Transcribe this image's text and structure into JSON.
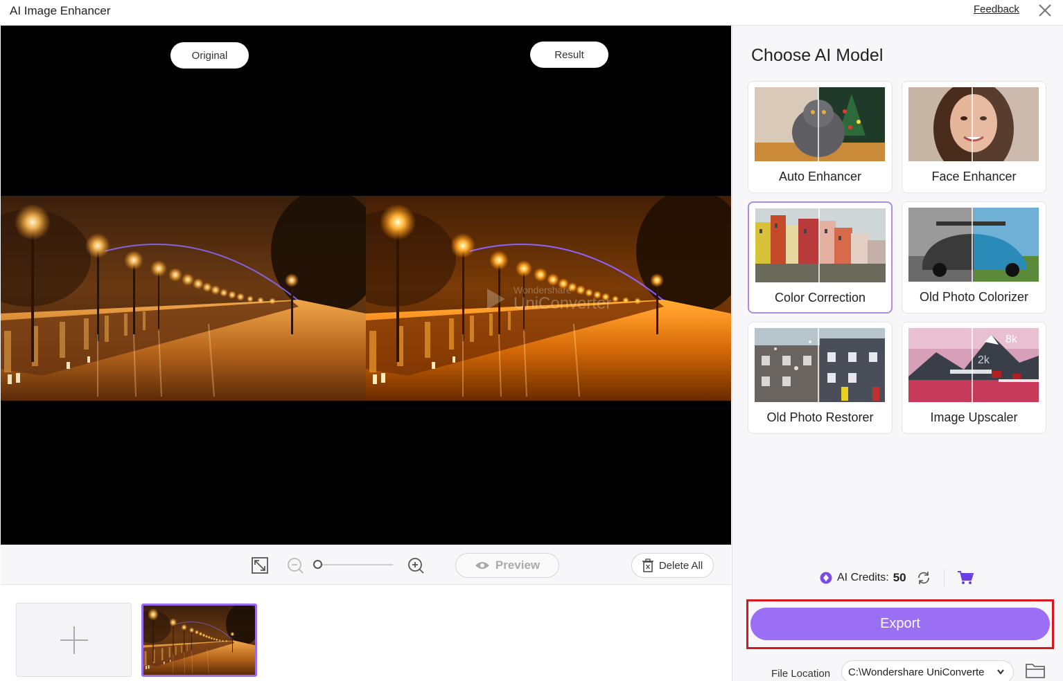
{
  "window": {
    "title": "AI Image Enhancer",
    "feedback_label": "Feedback"
  },
  "preview": {
    "original_label": "Original",
    "result_label": "Result",
    "watermark_small": "Wondershare",
    "watermark_big": "UniConverter"
  },
  "toolbar": {
    "preview_label": "Preview",
    "delete_all_label": "Delete All",
    "zoom_level": 0
  },
  "panel": {
    "title": "Choose AI Model",
    "models": [
      {
        "label": "Auto Enhancer",
        "selected": false
      },
      {
        "label": "Face Enhancer",
        "selected": false
      },
      {
        "label": "Color Correction",
        "selected": true
      },
      {
        "label": "Old Photo Colorizer",
        "selected": false
      },
      {
        "label": "Old Photo Restorer",
        "selected": false
      },
      {
        "label": "Image Upscaler",
        "selected": false
      }
    ],
    "upscaler_badges": {
      "from": "2k",
      "to": "8k"
    },
    "credits_label": "AI Credits:",
    "credits_value": "50",
    "export_label": "Export",
    "file_location_label": "File Location",
    "file_location_value": "C:\\Wondershare UniConverte"
  },
  "colors": {
    "accent": "#9a6ef5",
    "selected_border": "#a98be8",
    "highlight_frame": "#d9151e"
  }
}
